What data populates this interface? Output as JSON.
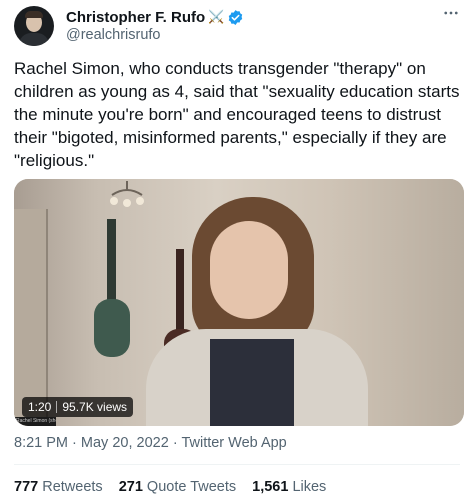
{
  "author": {
    "name": "Christopher F. Rufo",
    "name_emoji": "⚔️",
    "handle": "@realchrisrufo",
    "verified_color": "#1d9bf0"
  },
  "tweet": {
    "text": "Rachel Simon, who conducts transgender \"therapy\" on children as young as 4, said that \"sexuality education starts the minute you're born\" and encouraged teens to distrust their \"bigoted, misinformed parents,\" especially if they are \"religious.\""
  },
  "video": {
    "duration": "1:20",
    "views": "95.7K views",
    "caption_label": "Rachel Simon (she/her)",
    "watch_progress": 0
  },
  "meta": {
    "time": "8:21 PM",
    "separator": "·",
    "date": "May 20, 2022",
    "source": "Twitter Web App"
  },
  "stats": {
    "retweets_count": "777",
    "retweets_label": "Retweets",
    "quotes_count": "271",
    "quotes_label": "Quote Tweets",
    "likes_count": "1,561",
    "likes_label": "Likes"
  },
  "icons": {
    "verified": "verified-badge-icon",
    "more": "more-options-icon"
  }
}
